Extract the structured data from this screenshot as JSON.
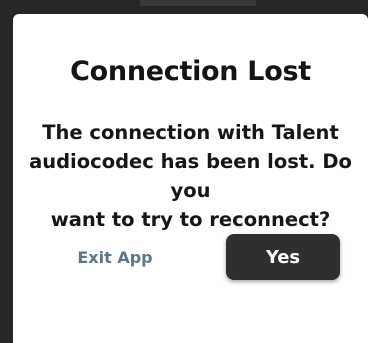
{
  "dialog": {
    "title": "Connection Lost",
    "message": "The connection with Talent\naudiocodec has been lost. Do you\nwant to try to reconnect?",
    "exit_label": "Exit App",
    "yes_label": "Yes"
  },
  "colors": {
    "dialog_bg": "#ffffff",
    "backdrop": "#262626",
    "primary_button": "#2f2f2f",
    "secondary_text": "#5f7684"
  }
}
